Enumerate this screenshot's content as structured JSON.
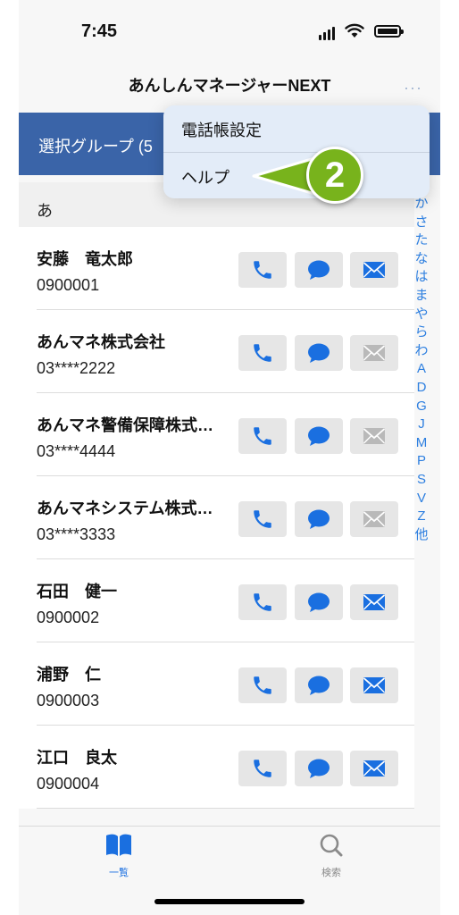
{
  "status": {
    "time": "7:45"
  },
  "nav": {
    "title": "あんしんマネージャーNEXT",
    "more": "···"
  },
  "group": {
    "label": "選択グループ (5"
  },
  "menu": {
    "items": [
      "電話帳設定",
      "ヘルプ"
    ]
  },
  "callout": {
    "number": "2",
    "color": "#78b31c"
  },
  "section": {
    "header": "あ"
  },
  "contacts": [
    {
      "name": "安藤　竜太郎",
      "number": "0900001",
      "mail_enabled": true
    },
    {
      "name": "あんマネ株式会社",
      "number": "03****2222",
      "mail_enabled": false
    },
    {
      "name": "あんマネ警備保障株式…",
      "number": "03****4444",
      "mail_enabled": false
    },
    {
      "name": "あんマネシステム株式…",
      "number": "03****3333",
      "mail_enabled": false
    },
    {
      "name": "石田　健一",
      "number": "0900002",
      "mail_enabled": true
    },
    {
      "name": "浦野　仁",
      "number": "0900003",
      "mail_enabled": true
    },
    {
      "name": "江口　良太",
      "number": "0900004",
      "mail_enabled": true
    }
  ],
  "index": [
    "か",
    "さ",
    "た",
    "な",
    "は",
    "ま",
    "や",
    "ら",
    "わ",
    "A",
    "D",
    "G",
    "J",
    "M",
    "P",
    "S",
    "V",
    "Z",
    "他"
  ],
  "tabs": {
    "list": "一覧",
    "search": "検索"
  },
  "colors": {
    "accent": "#1a6fe0",
    "group_bar": "#3a64a8",
    "disabled_icon": "#b9b9b9"
  },
  "icons": {
    "call": "phone-icon",
    "message": "message-icon",
    "mail": "mail-icon",
    "list": "book-icon",
    "search": "search-icon"
  }
}
